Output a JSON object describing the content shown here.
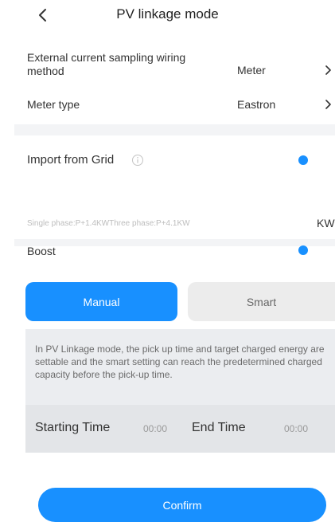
{
  "header": {
    "title": "PV linkage mode"
  },
  "wiring": {
    "label": "External current sampling wiring method",
    "value": "Meter"
  },
  "meter": {
    "label": "Meter type",
    "value": "Eastron"
  },
  "grid": {
    "label": "Import from Grid",
    "enabled": true,
    "hint": "Single phase:P+1.4KWThree phase:P+4.1KW",
    "unit": "KW"
  },
  "boost": {
    "label": "Boost",
    "enabled": true,
    "modes": [
      "Manual",
      "Smart"
    ],
    "selected_mode": "Manual"
  },
  "manual": {
    "description": "In PV Linkage mode, the pick up time and target charged energy are settable and the smart setting can reach the predetermined charged capacity before the pick-up time.",
    "start_label": "Starting Time",
    "start_value": "00:00",
    "end_label": "End Time",
    "end_value": "00:00"
  },
  "footer": {
    "confirm_label": "Confirm"
  },
  "colors": {
    "accent": "#1890ff",
    "panel": "#ebedf0",
    "divider": "#f3f4f6"
  }
}
